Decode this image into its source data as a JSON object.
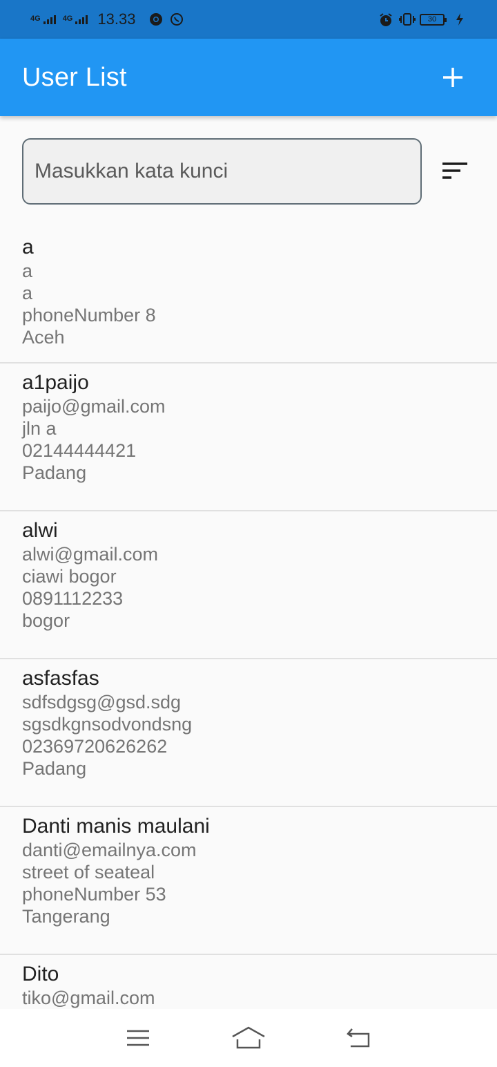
{
  "status_bar": {
    "network1": "4G",
    "network2": "4G",
    "time": "13.33",
    "battery": "30",
    "icons": [
      "chrome-icon",
      "whatsapp-icon",
      "alarm-icon",
      "vibrate-icon",
      "battery-icon",
      "charging-icon"
    ]
  },
  "app_bar": {
    "title": "User List",
    "add_icon": "plus-icon"
  },
  "search": {
    "placeholder": "Masukkan kata kunci",
    "value": "",
    "sort_icon": "sort-icon"
  },
  "users": [
    {
      "name": "a",
      "email": "a",
      "address": "a",
      "phone": "phoneNumber 8",
      "city": "Aceh"
    },
    {
      "name": "a1paijo",
      "email": "paijo@gmail.com",
      "address": "jln a",
      "phone": "02144444421",
      "city": "Padang"
    },
    {
      "name": "alwi",
      "email": "alwi@gmail.com",
      "address": "ciawi bogor",
      "phone": "0891112233",
      "city": "bogor"
    },
    {
      "name": "asfasfas",
      "email": "sdfsdgsg@gsd.sdg",
      "address": "sgsdkgnsodvondsng",
      "phone": "02369720626262",
      "city": "Padang"
    },
    {
      "name": "Danti manis maulani",
      "email": "danti@emailnya.com",
      "address": "street of seateal",
      "phone": "phoneNumber 53",
      "city": "Tangerang"
    },
    {
      "name": "Dito",
      "email": "tiko@gmail.com",
      "address": "",
      "phone": "",
      "city": ""
    }
  ],
  "nav_bar": {
    "icons": [
      "menu-icon",
      "home-icon",
      "back-icon"
    ]
  },
  "colors": {
    "primary": "#2196f3",
    "status_bar": "#1976c8",
    "background": "#fafafa"
  }
}
